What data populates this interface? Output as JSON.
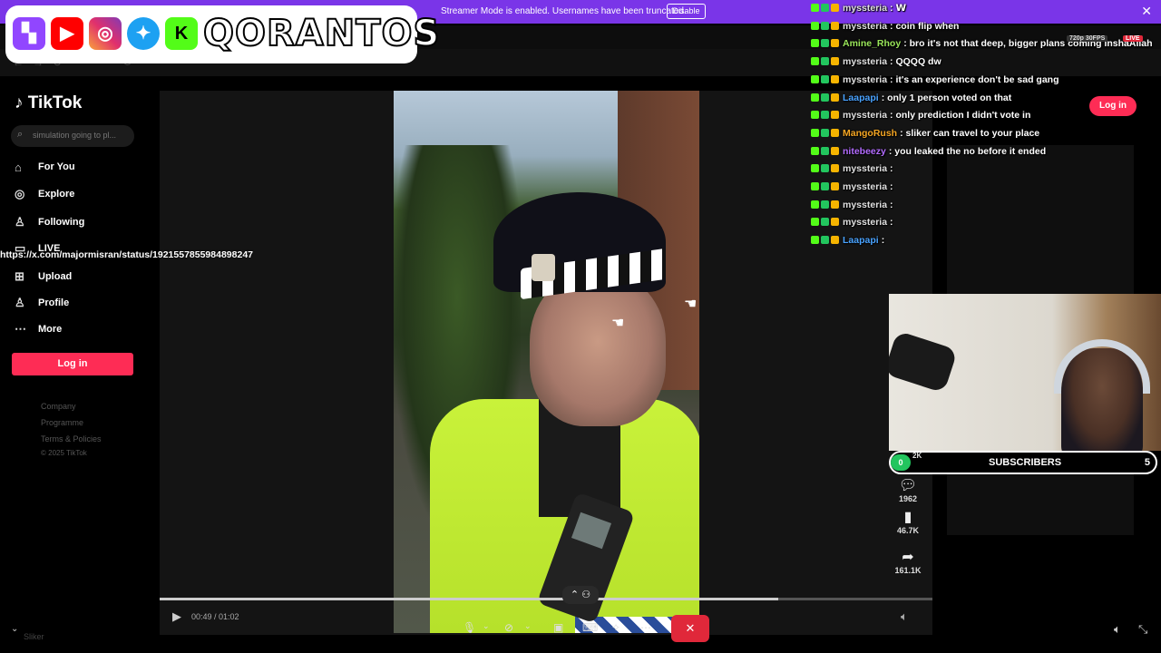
{
  "banner": {
    "text": "Streamer Mode is enabled. Usernames have been truncated.",
    "button": "Disable",
    "close": "✕"
  },
  "social": {
    "name": "QORANTOS",
    "icons": [
      "twitch-icon",
      "youtube-icon",
      "instagram-icon",
      "twitter-icon",
      "kick-icon"
    ]
  },
  "browser": {
    "url": "tiktok.com/@itsadden/video/7..."
  },
  "tiktok": {
    "logo": "TikTok",
    "search_placeholder": "simulation going to pl...",
    "nav": [
      {
        "label": "For You",
        "icon": "home-icon"
      },
      {
        "label": "Explore",
        "icon": "compass-icon"
      },
      {
        "label": "Following",
        "icon": "user-follow-icon"
      },
      {
        "label": "LIVE",
        "icon": "live-icon"
      },
      {
        "label": "Upload",
        "icon": "upload-icon"
      },
      {
        "label": "Profile",
        "icon": "person-icon"
      },
      {
        "label": "More",
        "icon": "more-icon"
      }
    ],
    "login": "Log in",
    "footer": [
      "Company",
      "Programme",
      "Terms & Policies",
      "© 2025 TikTok"
    ],
    "video": {
      "time": "00:49 / 01:02",
      "progress": 0.8
    },
    "actions": [
      {
        "icon": "comment-icon",
        "count": "1962"
      },
      {
        "icon": "bookmark-icon",
        "count": "46.7K"
      },
      {
        "icon": "share-icon",
        "count": "161.1K"
      }
    ],
    "login_top": "Log in"
  },
  "chat": {
    "messages": [
      {
        "user": "myssteria",
        "color": "#e0e0e0",
        "text": ": 𝗪"
      },
      {
        "user": "myssteria",
        "color": "#e0e0e0",
        "text": ": coin flip when"
      },
      {
        "user": "Amine_Rhoy",
        "color": "#9ae65a",
        "text": ": bro it's not that deep, bigger plans coming inshaAllah"
      },
      {
        "user": "myssteria",
        "color": "#e0e0e0",
        "text": ": QQQQ dw"
      },
      {
        "user": "myssteria",
        "color": "#e0e0e0",
        "text": ": it's an experience don't be sad gang"
      },
      {
        "user": "Laapapi",
        "color": "#4aa3ff",
        "text": ": only 1 person voted on that"
      },
      {
        "user": "myssteria",
        "color": "#e0e0e0",
        "text": ": only prediction I didn't vote in"
      },
      {
        "user": "MangoRush",
        "color": "#f5a623",
        "text": ": sliker can travel to your place"
      },
      {
        "user": "nitebeezy",
        "color": "#b36cff",
        "text": ": you leaked the no before it ended"
      },
      {
        "user": "myssteria",
        "color": "#e0e0e0",
        "text": ":"
      },
      {
        "user": "myssteria",
        "color": "#e0e0e0",
        "text": ":"
      },
      {
        "user": "myssteria",
        "color": "#e0e0e0",
        "text": ":"
      },
      {
        "user": "myssteria",
        "color": "#e0e0e0",
        "text": ":"
      },
      {
        "user": "Laapapi",
        "color": "#4aa3ff",
        "text": ":"
      }
    ],
    "link": "https://x.com/majormisran/status/1921557855984898247",
    "fps_badge": "720p 30FPS",
    "live_badge": "LIVE"
  },
  "subscribers": {
    "left": "0",
    "label": "SUBSCRIBERS",
    "right": "5",
    "partial": "2K"
  },
  "misc": {
    "bottom_user": "Sliker"
  },
  "colors": {
    "banner": "#7a35e8",
    "tiktok_red": "#fe2c55",
    "stop_red": "#e0283a"
  }
}
